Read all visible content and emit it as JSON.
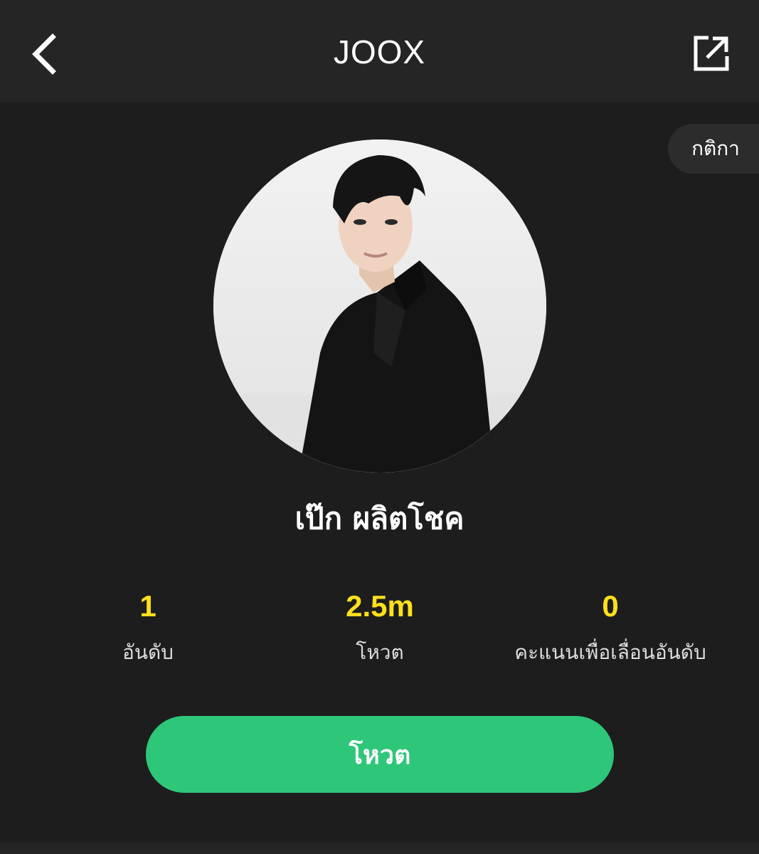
{
  "header": {
    "title": "JOOX",
    "back_icon": "chevron-left-icon",
    "share_icon": "external-link-icon"
  },
  "rules_label": "กติกา",
  "artist": {
    "name": "เป๊ก ผลิตโชค"
  },
  "stats": {
    "rank": {
      "value": "1",
      "label": "อันดับ"
    },
    "votes": {
      "value": "2.5m",
      "label": "โหวต"
    },
    "points": {
      "value": "0",
      "label": "คะแนนเพื่อเลื่อนอันดับ"
    }
  },
  "vote_button": {
    "label": "โหวต"
  },
  "colors": {
    "background": "#1d1d1d",
    "header": "#252525",
    "accent_yellow": "#ffe01b",
    "accent_green": "#2ec77a"
  }
}
